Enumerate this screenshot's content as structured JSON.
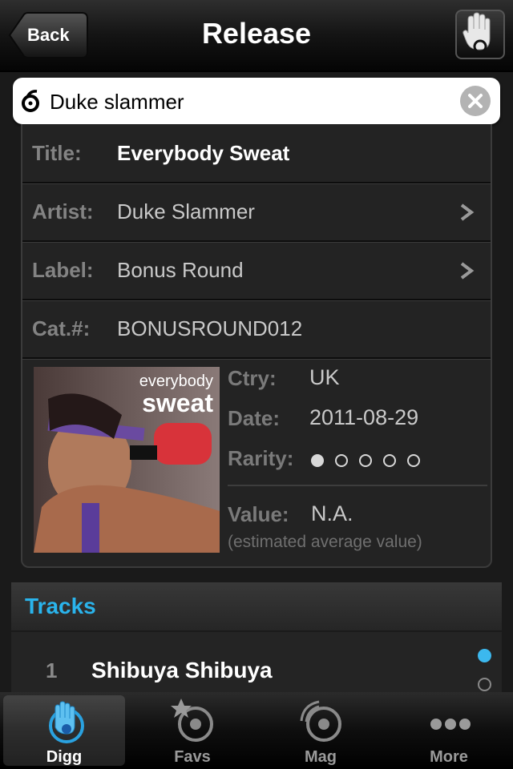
{
  "navbar": {
    "back_label": "Back",
    "title": "Release"
  },
  "search": {
    "value": "Duke slammer"
  },
  "release": {
    "title_label": "Title:",
    "title": "Everybody Sweat",
    "artist_label": "Artist:",
    "artist": "Duke Slammer",
    "label_label": "Label:",
    "label": "Bonus Round",
    "cat_label": "Cat.#:",
    "cat": "BONUSROUND012",
    "cover_text_top": "everybody",
    "cover_text_bottom": "sweat",
    "country_label": "Ctry:",
    "country": "UK",
    "date_label": "Date:",
    "date": "2011-08-29",
    "rarity_label": "Rarity:",
    "rarity": 1,
    "rarity_max": 5,
    "value_label": "Value:",
    "value": "N.A.",
    "value_note": "(estimated average value)"
  },
  "tracks": {
    "header": "Tracks",
    "items": [
      {
        "number": "1",
        "title": "Shibuya Shibuya"
      }
    ]
  },
  "tabbar": {
    "items": [
      {
        "label": "Digg",
        "icon": "hand-icon",
        "selected": true
      },
      {
        "label": "Favs",
        "icon": "star-record-icon",
        "selected": false
      },
      {
        "label": "Mag",
        "icon": "signal-record-icon",
        "selected": false
      },
      {
        "label": "More",
        "icon": "more-dots-icon",
        "selected": false
      }
    ]
  },
  "colors": {
    "accent": "#2ab4ec",
    "label_gray": "#838383"
  }
}
